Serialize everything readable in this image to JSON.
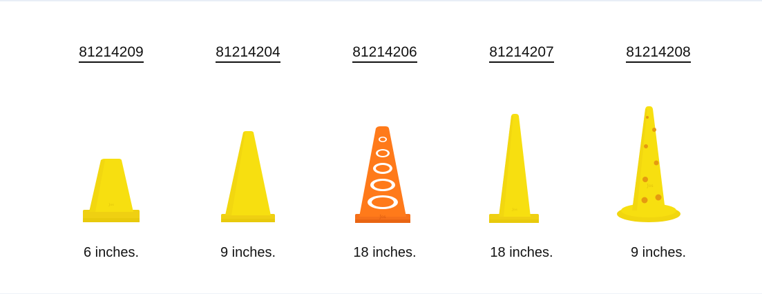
{
  "products": [
    {
      "sku": "81214209",
      "size": "6 inches.",
      "color": "#f7df10",
      "cone_icon": "short-cone-icon"
    },
    {
      "sku": "81214204",
      "size": "9 inches.",
      "color": "#f7df10",
      "cone_icon": "cone-icon"
    },
    {
      "sku": "81214206",
      "size": "18 inches.",
      "color": "#ff7a1a",
      "cone_icon": "cutout-cone-icon"
    },
    {
      "sku": "81214207",
      "size": "18 inches.",
      "color": "#f7df10",
      "cone_icon": "tall-cone-icon"
    },
    {
      "sku": "81214208",
      "size": "9 inches.",
      "color": "#f7df10",
      "cone_icon": "hurdle-cone-icon"
    }
  ]
}
